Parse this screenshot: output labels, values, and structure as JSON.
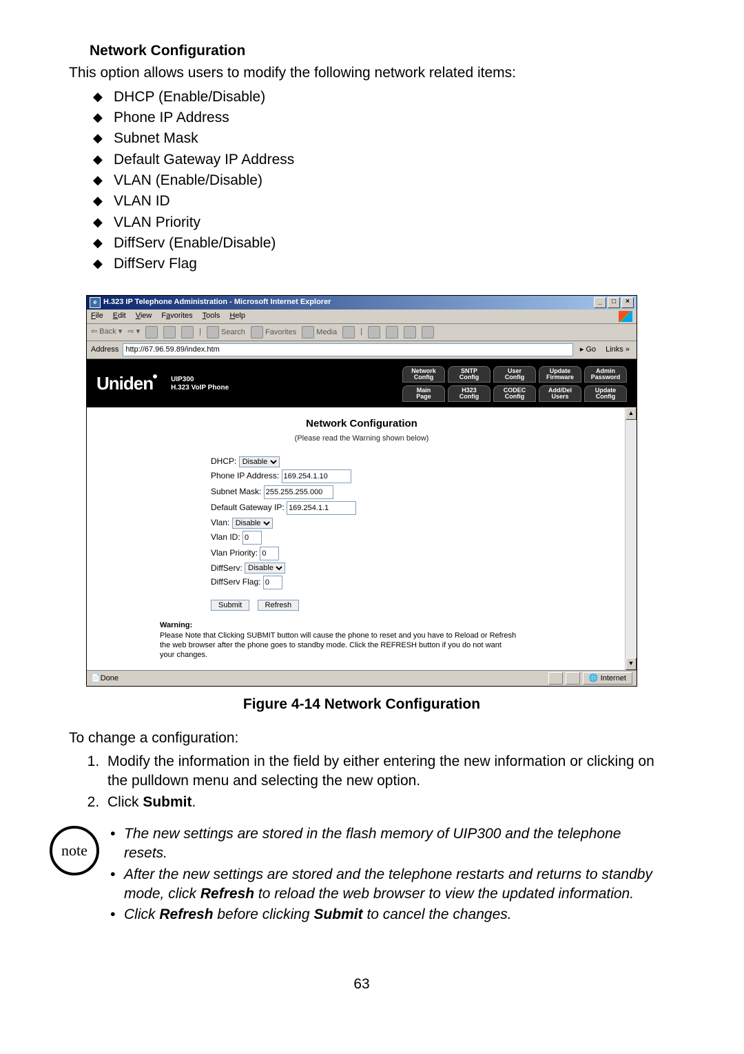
{
  "section_title": "Network Configuration",
  "intro": "This option allows users to modify the following network related items:",
  "bullets": [
    "DHCP (Enable/Disable)",
    "Phone IP Address",
    "Subnet Mask",
    "Default Gateway IP Address",
    "VLAN (Enable/Disable)",
    "VLAN ID",
    "VLAN Priority",
    "DiffServ (Enable/Disable)",
    "DiffServ Flag"
  ],
  "ie": {
    "title": "H.323 IP Telephone Administration - Microsoft Internet Explorer",
    "menu": {
      "file": "File",
      "edit": "Edit",
      "view": "View",
      "favorites": "Favorites",
      "tools": "Tools",
      "help": "Help"
    },
    "toolbar": {
      "back": "Back",
      "search": "Search",
      "favorites": "Favorites",
      "media": "Media"
    },
    "address_label": "Address",
    "address_value": "http://67.96.59.89/index.htm",
    "go": "Go",
    "links": "Links",
    "status_done": "Done",
    "status_zone": "Internet"
  },
  "banner": {
    "brand": "Uniden",
    "sub1": "UIP300",
    "sub2": "H.323 VoIP Phone",
    "tabs_top": [
      "Network\nConfig",
      "SNTP\nConfig",
      "User\nConfig",
      "Update\nFirmware",
      "Admin\nPassword"
    ],
    "tabs_bottom": [
      "Main\nPage",
      "H323\nConfig",
      "CODEC\nConfig",
      "Add/Del\nUsers",
      "Update\nConfig"
    ]
  },
  "form": {
    "title": "Network Configuration",
    "sub": "(Please read the Warning shown below)",
    "dhcp_label": "DHCP:",
    "dhcp_value": "Disable",
    "phoneip_label": "Phone IP Address:",
    "phoneip_value": "169.254.1.10",
    "subnet_label": "Subnet Mask:",
    "subnet_value": "255.255.255.000",
    "gateway_label": "Default Gateway IP:",
    "gateway_value": "169.254.1.1",
    "vlan_label": "Vlan:",
    "vlan_value": "Disable",
    "vlanid_label": "Vlan ID:",
    "vlanid_value": "0",
    "vlanprio_label": "Vlan Priority:",
    "vlanprio_value": "0",
    "diffserv_label": "DiffServ:",
    "diffserv_value": "Disable",
    "diffservflag_label": "DiffServ Flag:",
    "diffservflag_value": "0",
    "submit": "Submit",
    "refresh": "Refresh",
    "warning_title": "Warning:",
    "warning_body": "Please Note that Clicking SUBMIT button will cause the phone to reset and you have to Reload or Refresh the web browser after the phone goes to standby mode. Click the REFRESH button if you do not want your changes."
  },
  "figure_caption": "Figure 4-14 Network Configuration",
  "change_intro": "To change a configuration:",
  "steps": [
    "Modify the information in the field by either entering the new information or clicking on the pulldown menu and selecting the new option.",
    "Click Submit."
  ],
  "note_word": "note",
  "notes": [
    "The new settings are stored in the flash memory of UIP300 and the telephone resets.",
    "After the new settings are stored and the telephone restarts and returns to standby mode, click Refresh to reload the web browser to view the updated information.",
    "Click Refresh before clicking Submit to cancel the changes."
  ],
  "page_number": "63"
}
